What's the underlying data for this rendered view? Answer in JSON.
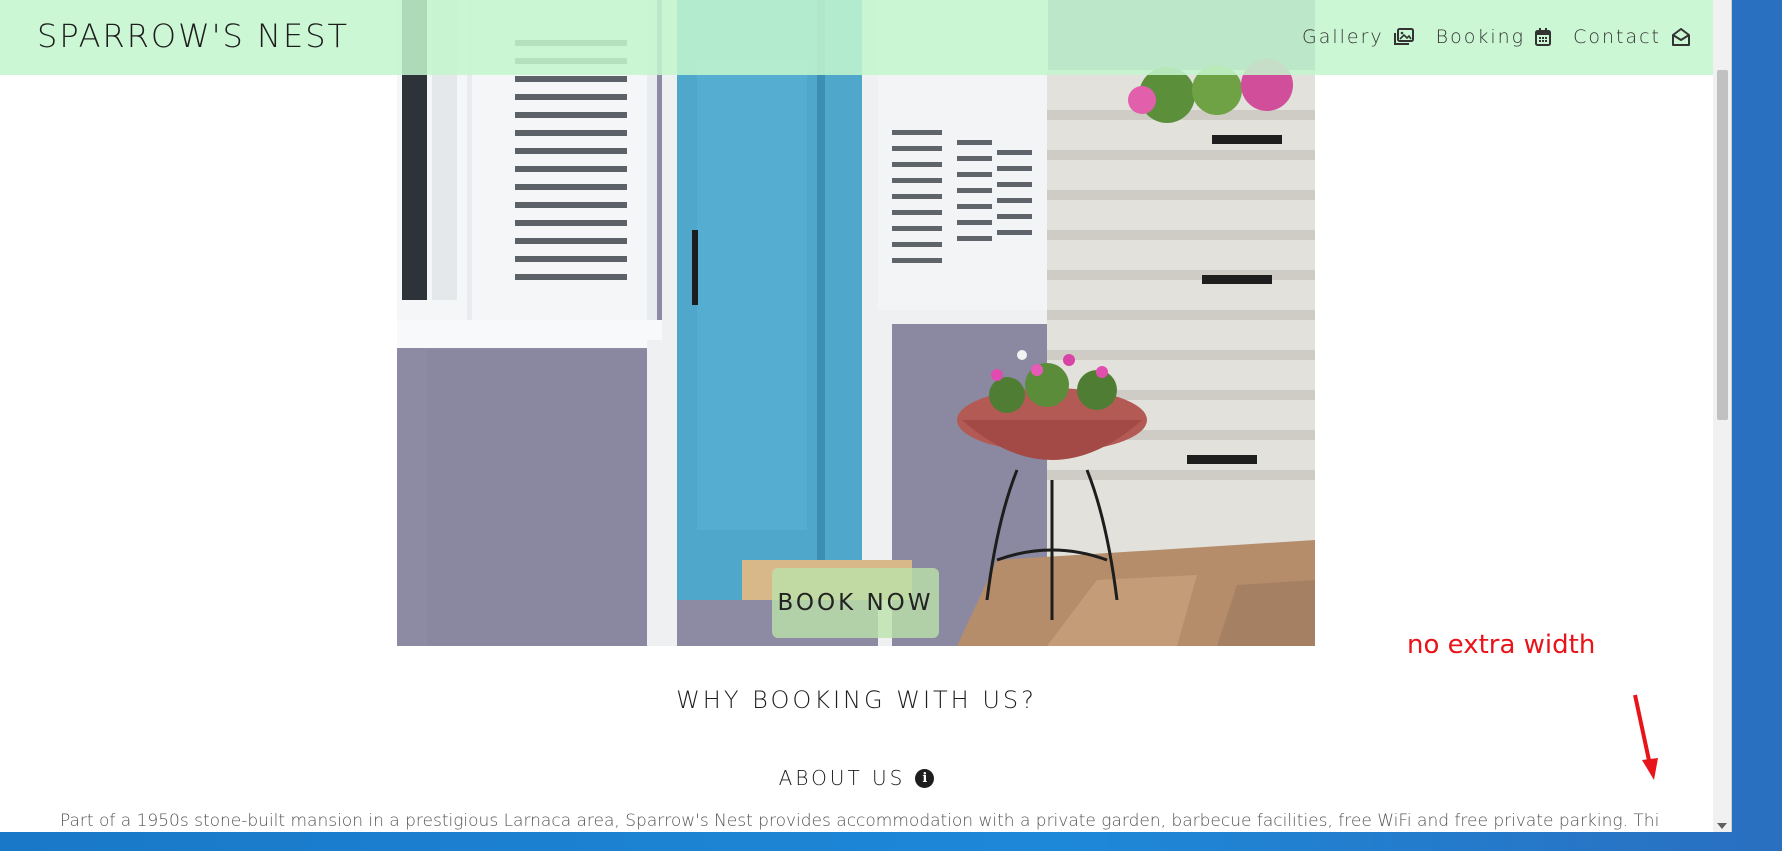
{
  "navbar": {
    "brand": "SPARROW'S NEST",
    "links": [
      {
        "label": "Gallery",
        "icon": "gallery-icon"
      },
      {
        "label": "Booking",
        "icon": "calendar-icon"
      },
      {
        "label": "Contact",
        "icon": "envelope-open-icon"
      }
    ],
    "background_color": "#c4f6ce"
  },
  "hero": {
    "cta_label": "BOOK NOW",
    "cta_color": "#bce2aa"
  },
  "main": {
    "section_title": "WHY BOOKING WITH US?",
    "about_title": "ABOUT US",
    "about_icon": "info-icon",
    "about_text": "Part of a 1950s stone-built mansion in a prestigious Larnaca area, Sparrow's Nest provides accommodation with a private garden, barbecue facilities, free WiFi and free private parking. This fully"
  },
  "annotation": {
    "text": "no extra width",
    "color": "#e8141a"
  }
}
